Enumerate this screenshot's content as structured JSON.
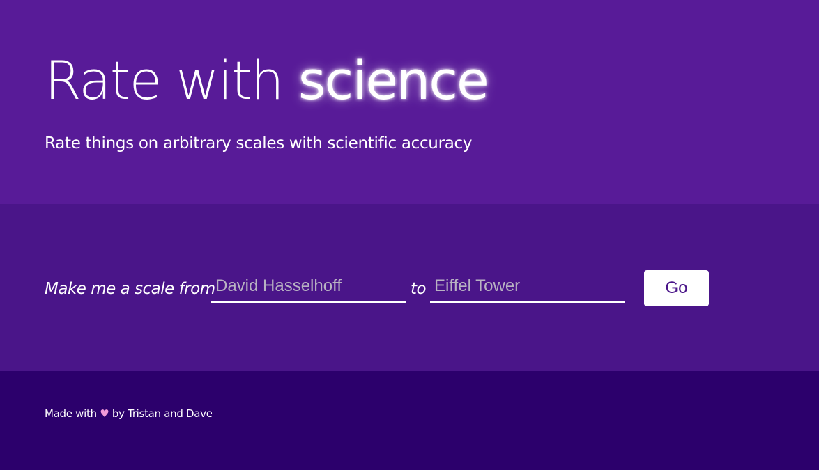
{
  "hero": {
    "title_plain": "Rate with",
    "title_emphasis": "science",
    "subtitle": "Rate things on arbitrary scales with scientific accuracy"
  },
  "form": {
    "prompt_from": "Make me a scale from",
    "from_placeholder": "David Hasselhoff",
    "prompt_to": "to",
    "to_placeholder": "Eiffel Tower",
    "go_label": "Go"
  },
  "footer": {
    "made_with": "Made with",
    "heart": "♥",
    "by": "by",
    "author1": "Tristan",
    "and": "and",
    "author2": "Dave",
    "heart_color": "#f19ad8"
  },
  "colors": {
    "hero_bg": "#581b98",
    "form_bg": "#4a1589",
    "footer_bg": "#2c006c",
    "button_text": "#4a1589"
  }
}
